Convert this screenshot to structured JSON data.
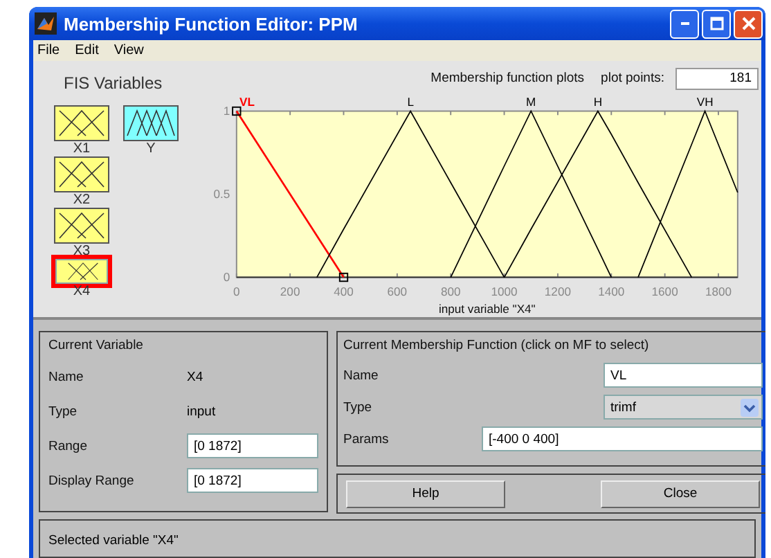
{
  "window": {
    "title": "Membership Function Editor: PPM"
  },
  "menu": [
    "File",
    "Edit",
    "View"
  ],
  "fis_variables": {
    "title": "FIS Variables",
    "items": [
      {
        "label": "X1",
        "kind": "input",
        "selected": false
      },
      {
        "label": "Y",
        "kind": "output",
        "selected": false
      },
      {
        "label": "X2",
        "kind": "input",
        "selected": false
      },
      {
        "label": "X3",
        "kind": "input",
        "selected": false
      },
      {
        "label": "X4",
        "kind": "input",
        "selected": true
      }
    ]
  },
  "plot": {
    "plot_points_label": "plot points:",
    "plot_points": "181",
    "chart_data": {
      "type": "line",
      "title": "Membership function plots",
      "xlabel": "input variable \"X4\"",
      "x": [
        0,
        300,
        400,
        650,
        800,
        1000,
        1100,
        1350,
        1400,
        1500,
        1700,
        1750,
        1872
      ],
      "xlim": [
        0,
        1872
      ],
      "ylim": [
        0,
        1
      ],
      "xticks": [
        0,
        200,
        400,
        600,
        800,
        1000,
        1200,
        1400,
        1600,
        1800
      ],
      "yticks": [
        0,
        0.5,
        1
      ],
      "series": [
        {
          "name": "VL",
          "color": "#ff0000",
          "values": [
            1,
            0.25,
            0,
            null,
            null,
            null,
            null,
            null,
            null,
            null,
            null,
            null,
            null
          ]
        },
        {
          "name": "L",
          "color": "#000000",
          "values": [
            null,
            0,
            0.29,
            1,
            0.57,
            0,
            null,
            null,
            null,
            null,
            null,
            null,
            null
          ]
        },
        {
          "name": "M",
          "color": "#000000",
          "values": [
            null,
            null,
            null,
            null,
            0,
            0.67,
            1,
            0.17,
            0,
            null,
            null,
            null,
            null
          ]
        },
        {
          "name": "H",
          "color": "#000000",
          "values": [
            null,
            null,
            null,
            null,
            null,
            0,
            0.29,
            1,
            0.86,
            0.57,
            0,
            null,
            null
          ]
        },
        {
          "name": "VH",
          "color": "#000000",
          "values": [
            null,
            null,
            null,
            null,
            null,
            null,
            null,
            null,
            null,
            0,
            0.8,
            1,
            0.51
          ]
        }
      ]
    }
  },
  "current_variable": {
    "title": "Current Variable",
    "name_label": "Name",
    "name": "X4",
    "type_label": "Type",
    "type": "input",
    "range_label": "Range",
    "range": "[0 1872]",
    "display_range_label": "Display Range",
    "display_range": "[0 1872]"
  },
  "current_mf": {
    "title": "Current Membership Function (click on MF to select)",
    "name_label": "Name",
    "name": "VL",
    "type_label": "Type",
    "type": "trimf",
    "params_label": "Params",
    "params": "[-400 0 400]"
  },
  "buttons": [
    "Help",
    "Close"
  ],
  "status": "Selected variable \"X4\""
}
